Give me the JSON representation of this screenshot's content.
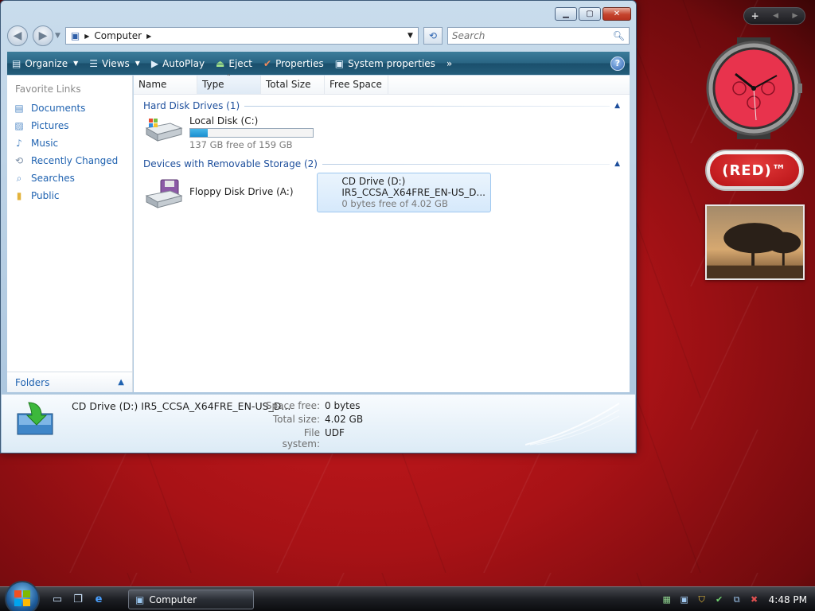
{
  "window": {
    "address": {
      "location": "Computer"
    },
    "search": {
      "placeholder": "Search"
    },
    "toolbar": {
      "organize": "Organize",
      "views": "Views",
      "autoplay": "AutoPlay",
      "eject": "Eject",
      "properties": "Properties",
      "system_properties": "System properties",
      "overflow": "»",
      "help": "?"
    },
    "nav_pane": {
      "header": "Favorite Links",
      "links": [
        "Documents",
        "Pictures",
        "Music",
        "Recently Changed",
        "Searches",
        "Public"
      ],
      "folders_label": "Folders"
    },
    "columns": [
      "Name",
      "Type",
      "Total Size",
      "Free Space"
    ],
    "groups": {
      "hard_disks": {
        "label": "Hard Disk Drives (1)",
        "drives": [
          {
            "name": "Local Disk (C:)",
            "free_text": "137 GB free of 159 GB",
            "used_fraction": 0.14
          }
        ]
      },
      "removable": {
        "label": "Devices with Removable Storage (2)",
        "drives": [
          {
            "name": "Floppy Disk Drive (A:)"
          },
          {
            "name": "CD Drive (D:)",
            "label": "IR5_CCSA_X64FRE_EN-US_D...",
            "free_text": "0 bytes free of 4.02 GB"
          }
        ]
      }
    },
    "details": {
      "title": "CD Drive (D:) IR5_CCSA_X64FRE_EN-US_D...",
      "fields": [
        {
          "label": "Space free:",
          "value": "0 bytes"
        },
        {
          "label": "Total size:",
          "value": "4.02 GB"
        },
        {
          "label": "File system:",
          "value": "UDF"
        }
      ]
    }
  },
  "gadgets": {
    "controls": {
      "add": "+",
      "prev": "◀",
      "next": "▶"
    },
    "red_badge": "(RED)™"
  },
  "taskbar": {
    "task_label": "Computer",
    "clock": "4:48 PM"
  },
  "colors": {
    "desktop": "#b5161a",
    "toolbar": "#2a6684",
    "link": "#1f62b0",
    "group_header": "#1e4f9c"
  }
}
